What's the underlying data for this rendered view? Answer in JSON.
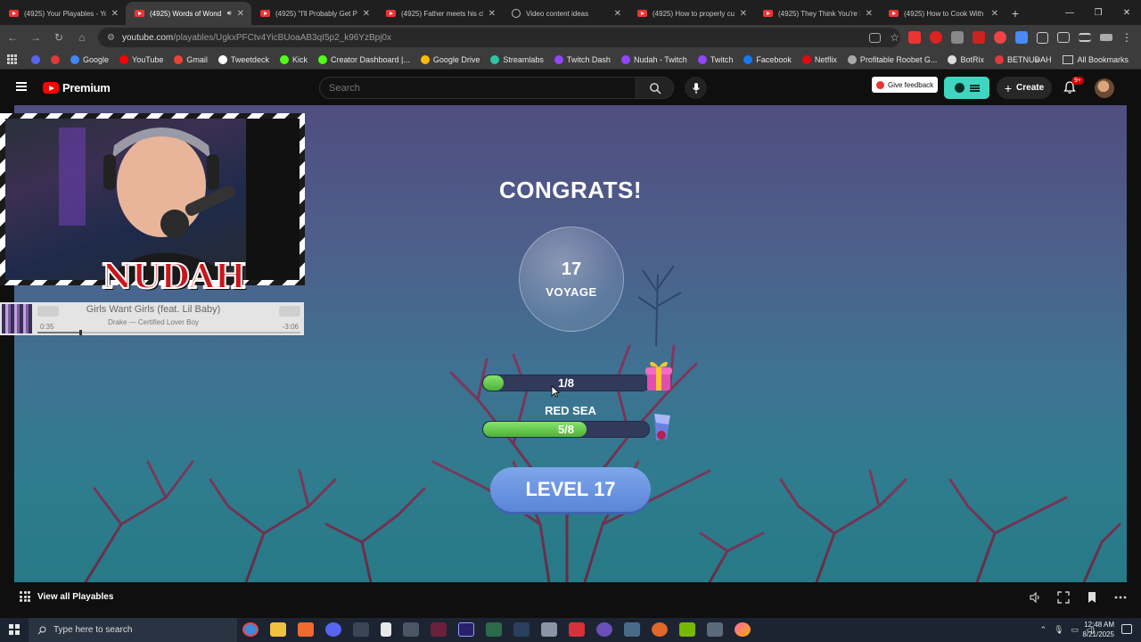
{
  "browser": {
    "tabs": [
      {
        "title": "(4925) Your Playables - Yo",
        "active": false,
        "audio": false,
        "favicon": "youtube-icon"
      },
      {
        "title": "(4925) Words of Wond",
        "active": true,
        "audio": true,
        "favicon": "youtube-icon"
      },
      {
        "title": "(4925) \"I'll Probably Get P",
        "active": false,
        "audio": false,
        "favicon": "youtube-icon"
      },
      {
        "title": "(4925) Father meets his ch",
        "active": false,
        "audio": false,
        "favicon": "youtube-icon"
      },
      {
        "title": "Video content ideas",
        "active": false,
        "audio": false,
        "favicon": "globe-icon"
      },
      {
        "title": "(4925) How to properly cu",
        "active": false,
        "audio": false,
        "favicon": "youtube-icon"
      },
      {
        "title": "(4925) They Think You're S",
        "active": false,
        "audio": false,
        "favicon": "youtube-icon"
      },
      {
        "title": "(4925) How to Cook With",
        "active": false,
        "audio": false,
        "favicon": "youtube-icon"
      }
    ],
    "url_host": "youtube.com",
    "url_path": "/playables/UgkxPFCtv4YicBUoaAB3qI5p2_k96YzBpj0x",
    "bookmarks": [
      {
        "label": "",
        "color": "#5865f2",
        "icon": "discord-icon"
      },
      {
        "label": "",
        "color": "#e03a3a",
        "icon": "record-icon"
      },
      {
        "label": "Google",
        "color": "#4285f4",
        "icon": "google-icon"
      },
      {
        "label": "YouTube",
        "color": "#ff0000",
        "icon": "youtube-icon"
      },
      {
        "label": "Gmail",
        "color": "#ea4335",
        "icon": "gmail-icon"
      },
      {
        "label": "Tweetdeck",
        "color": "#ffffff",
        "icon": "x-icon"
      },
      {
        "label": "Kick",
        "color": "#53fc18",
        "icon": "kick-icon"
      },
      {
        "label": "Creator Dashboard |...",
        "color": "#53fc18",
        "icon": "kick-icon"
      },
      {
        "label": "Google Drive",
        "color": "#fbbc04",
        "icon": "drive-icon"
      },
      {
        "label": "Streamlabs",
        "color": "#31c3a2",
        "icon": "streamlabs-icon"
      },
      {
        "label": "Twitch Dash",
        "color": "#9146ff",
        "icon": "twitch-icon"
      },
      {
        "label": "Nudah - Twitch",
        "color": "#9146ff",
        "icon": "twitch-icon"
      },
      {
        "label": "Twitch",
        "color": "#9146ff",
        "icon": "twitch-icon"
      },
      {
        "label": "Facebook",
        "color": "#1877f2",
        "icon": "facebook-icon"
      },
      {
        "label": "Netflix",
        "color": "#e50914",
        "icon": "netflix-icon"
      },
      {
        "label": "Profitable Roobet G...",
        "color": "#aaaaaa",
        "icon": "globe-icon"
      },
      {
        "label": "BotRix",
        "color": "#dddddd",
        "icon": "botrix-icon"
      },
      {
        "label": "BETNUDAH",
        "color": "#e03a3a",
        "icon": "record-icon"
      }
    ],
    "all_bookmarks": "All Bookmarks"
  },
  "youtube": {
    "logo_text": "Premium",
    "search_placeholder": "Search",
    "feedback_label": "Give feedback",
    "create_label": "Create",
    "notif_badge": "9+",
    "brand_color": "#ff0000",
    "accent_pill": "#3ed6c0"
  },
  "game": {
    "heading": "CONGRATS!",
    "level_number": "17",
    "level_word": "VOYAGE",
    "progress1": {
      "text": "1/8",
      "fraction": 0.125
    },
    "region_label": "RED SEA",
    "progress2": {
      "text": "5/8",
      "fraction": 0.625
    },
    "level_button": "LEVEL 17"
  },
  "overlay": {
    "streamer_name": "NUDAH",
    "song_title": "Girls Want Girls (feat. Lil Baby)",
    "song_artist": "Drake — Certified Lover Boy",
    "time_elapsed": "0:35",
    "time_remaining": "-3:06",
    "song_progress": 0.16
  },
  "bottom_bar": {
    "view_all": "View all Playables"
  },
  "taskbar": {
    "search_placeholder": "Type here to search",
    "time": "12:48 AM",
    "date": "8/21/2025"
  }
}
